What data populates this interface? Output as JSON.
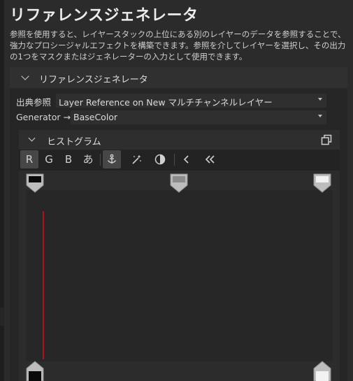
{
  "title": "リファレンスジェネレータ",
  "description": "参照を使用すると、レイヤースタックの上位にある別のレイヤーのデータを参照することで、強力なプロシージャルエフェクトを構築できます。参照を介してレイヤーを選択し、その出力の1つをマスクまたはジェネレーターの入力として使用できます。",
  "section": {
    "title": "リファレンスジェネレータ",
    "fields": [
      {
        "label": "出典参照",
        "value": "Layer Reference on New マルチチャンネルレイヤー"
      },
      {
        "label": "Generator →",
        "value": "BaseColor"
      }
    ]
  },
  "histogram": {
    "title": "ヒストグラム",
    "channels": [
      "R",
      "G",
      "B",
      "あ"
    ],
    "active_channel": "R",
    "levels": {
      "input_black": 0.0,
      "input_gray": 0.5,
      "input_white": 1.0,
      "output_black": 0.0,
      "output_white": 1.0
    },
    "colors": {
      "accent_line": "#b3121c",
      "background": "#2b2b2b"
    }
  },
  "icons": {
    "popout": "popout-window-icon",
    "anchor": "anchor-icon",
    "wand": "magic-wand-icon",
    "contrast": "contrast-icon",
    "prev": "chevron-left-icon",
    "first": "double-chevron-left-icon"
  }
}
